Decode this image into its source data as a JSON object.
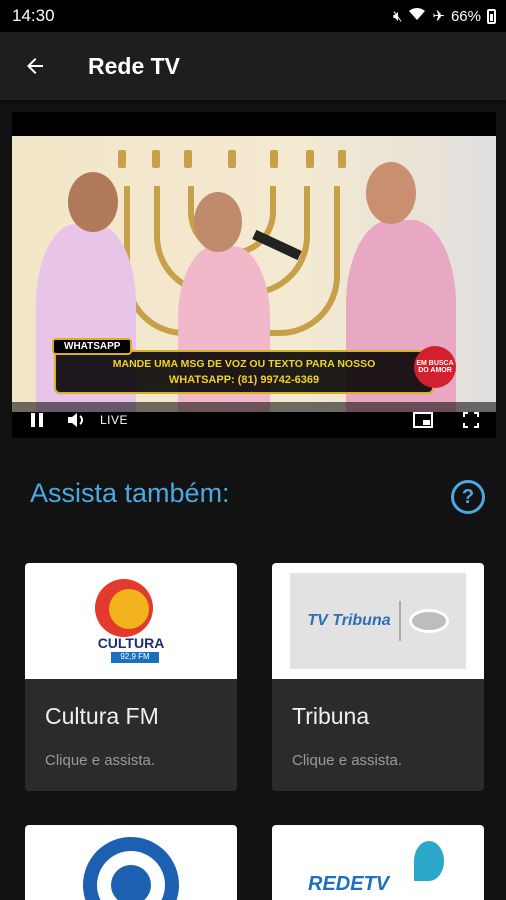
{
  "status_bar": {
    "time": "14:30",
    "battery": "66%",
    "icons": [
      "mute-icon",
      "wifi-icon",
      "airplane-icon",
      "battery-icon"
    ]
  },
  "app_bar": {
    "title": "Rede TV",
    "back_icon": "arrow-left-icon"
  },
  "player": {
    "ticker_label": "WHATSAPP",
    "ticker_line1": "MANDE UMA MSG DE VOZ OU TEXTO PARA NOSSO",
    "ticker_line2": "WHATSAPP: (81) 99742-6369",
    "badge": "EM BUSCA DO AMOR",
    "live_label": "LIVE",
    "controls": [
      "pause-icon",
      "volume-icon",
      "picture-in-picture-icon",
      "fullscreen-icon"
    ]
  },
  "section": {
    "title": "Assista também:",
    "help_icon": "?"
  },
  "colors": {
    "accent": "#4ba8e0",
    "background": "#121212",
    "card": "#2b2b2b"
  },
  "channels": [
    {
      "name": "Cultura FM",
      "subtitle": "Clique e assista.",
      "logo_text": "CULTURA",
      "logo_sub": "92,9 FM"
    },
    {
      "name": "Tribuna",
      "subtitle": "Clique e assista.",
      "logo_text": "TV Tribuna"
    },
    {
      "name": "",
      "subtitle": "",
      "logo_text": ""
    },
    {
      "name": "",
      "subtitle": "",
      "logo_text": "REDETV"
    }
  ]
}
